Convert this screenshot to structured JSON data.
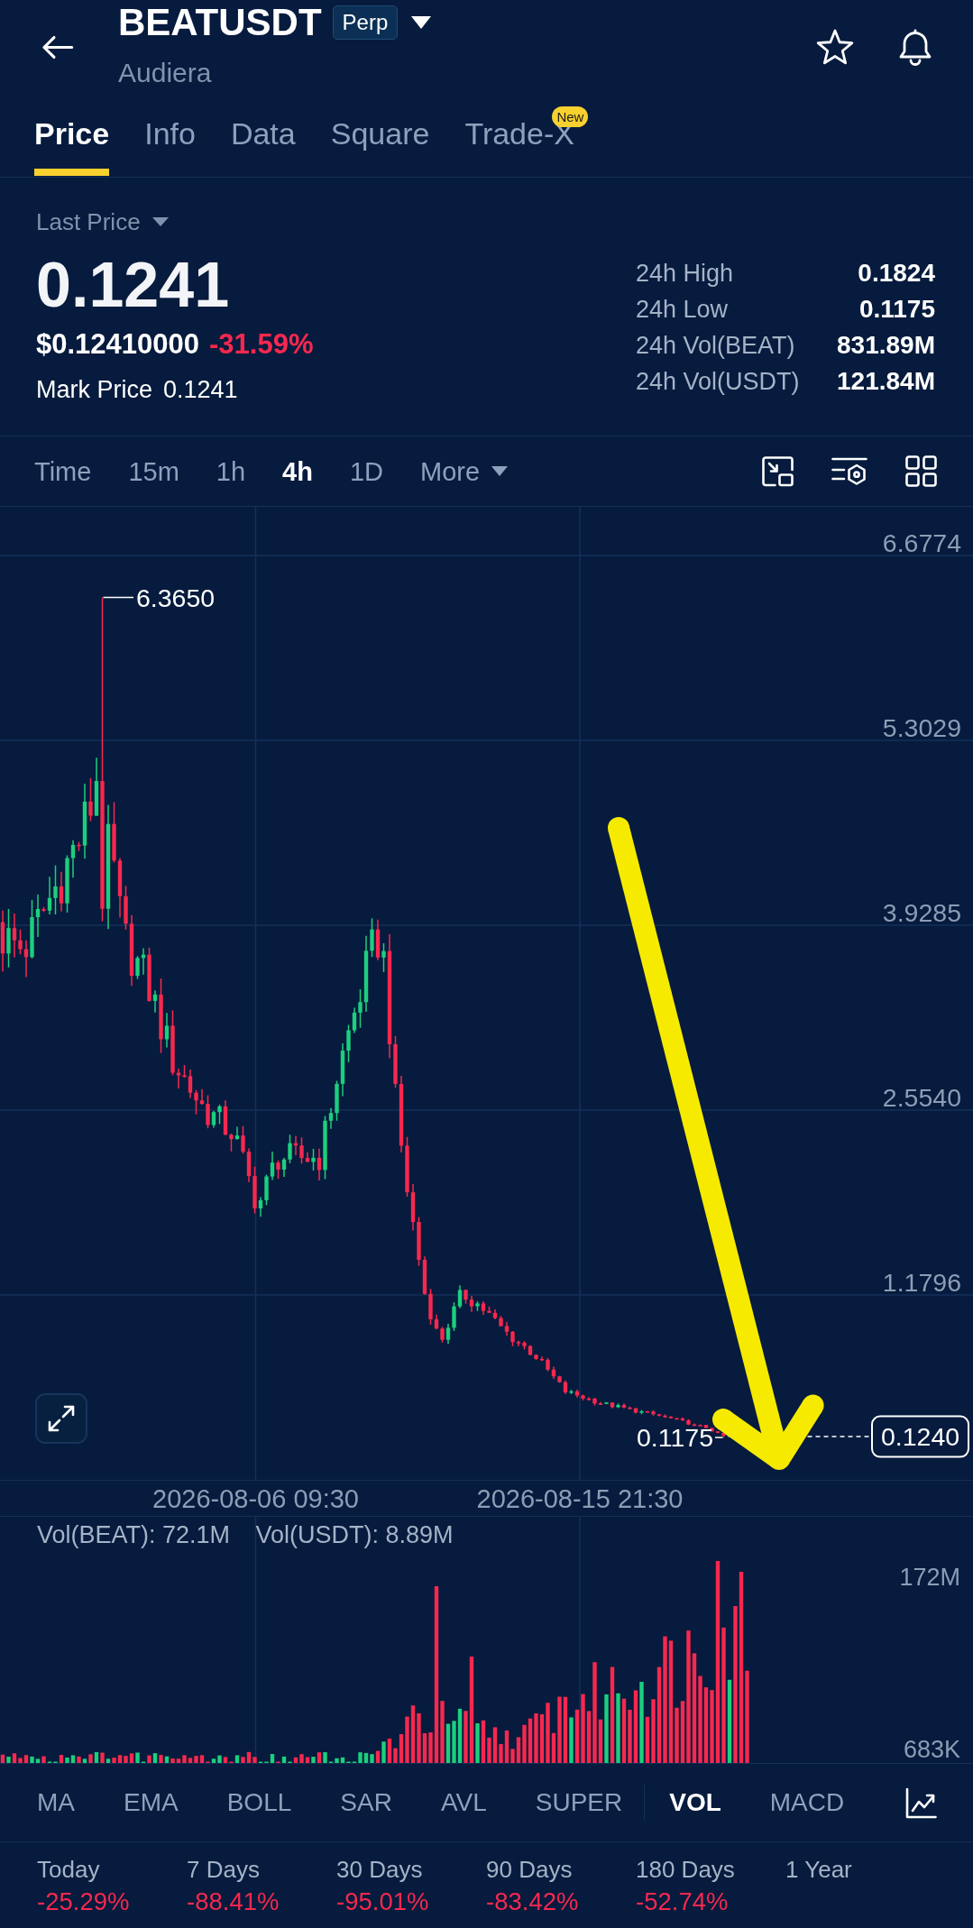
{
  "header": {
    "symbol": "BEATUSDT",
    "contract_type": "Perp",
    "name": "Audiera"
  },
  "tabs": [
    {
      "label": "Price",
      "selected": true
    },
    {
      "label": "Info",
      "selected": false
    },
    {
      "label": "Data",
      "selected": false
    },
    {
      "label": "Square",
      "selected": false
    },
    {
      "label": "Trade-X",
      "selected": false,
      "badge": "New"
    }
  ],
  "price": {
    "selector": "Last Price",
    "last": "0.1241",
    "usd": "$0.12410000",
    "change": "-31.59%",
    "negative": true,
    "mark_label": "Mark Price",
    "mark_value": "0.1241"
  },
  "stats": [
    {
      "label": "24h High",
      "value": "0.1824"
    },
    {
      "label": "24h Low",
      "value": "0.1175"
    },
    {
      "label": "24h Vol(BEAT)",
      "value": "831.89M"
    },
    {
      "label": "24h Vol(USDT)",
      "value": "121.84M"
    }
  ],
  "intervals": [
    {
      "label": "Time",
      "kind": "option",
      "selected": false
    },
    {
      "label": "15m",
      "kind": "option",
      "selected": false
    },
    {
      "label": "1h",
      "kind": "option",
      "selected": false
    },
    {
      "label": "4h",
      "kind": "option",
      "selected": true
    },
    {
      "label": "1D",
      "kind": "option",
      "selected": false
    },
    {
      "label": "More",
      "kind": "menu",
      "selected": false
    }
  ],
  "chart": {
    "price_ticks": [
      "6.6774",
      "5.3029",
      "3.9285",
      "2.5540",
      "1.1796"
    ],
    "high_label": "6.3650",
    "low_label": "0.1175",
    "current_price": "0.1240",
    "time_ticks": [
      "2026-08-06 09:30",
      "2026-08-15 21:30"
    ]
  },
  "volume": {
    "legend": [
      "Vol(BEAT): 72.1M",
      "Vol(USDT): 8.89M"
    ],
    "ticks": [
      "172M",
      "683K"
    ]
  },
  "indicators": {
    "main": [
      {
        "label": "MA",
        "selected": false
      },
      {
        "label": "EMA",
        "selected": false
      },
      {
        "label": "BOLL",
        "selected": false
      },
      {
        "label": "SAR",
        "selected": false
      },
      {
        "label": "AVL",
        "selected": false
      },
      {
        "label": "SUPER",
        "selected": false
      }
    ],
    "sub": [
      {
        "label": "VOL",
        "selected": true
      },
      {
        "label": "MACD",
        "selected": false
      }
    ]
  },
  "performance": [
    {
      "period": "Today",
      "change": "-25.29%",
      "negative": true
    },
    {
      "period": "7 Days",
      "change": "-88.41%",
      "negative": true
    },
    {
      "period": "30 Days",
      "change": "-95.01%",
      "negative": true
    },
    {
      "period": "90 Days",
      "change": "-83.42%",
      "negative": true
    },
    {
      "period": "180 Days",
      "change": "-52.74%",
      "negative": true
    },
    {
      "period": "1 Year"
    }
  ]
}
